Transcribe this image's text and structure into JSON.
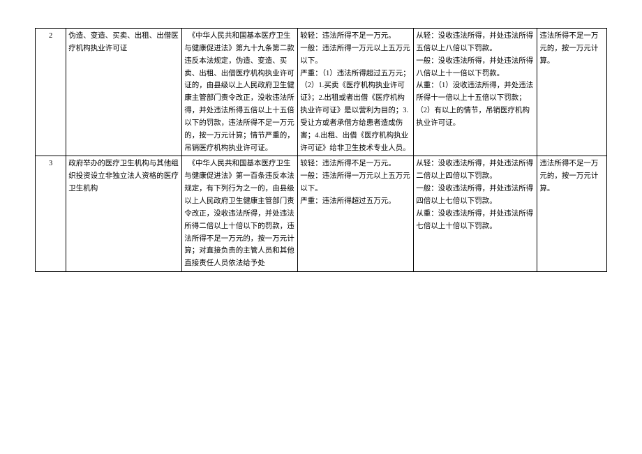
{
  "rows": [
    {
      "num": "2",
      "c2": "伪造、变造、买卖、出租、出借医疗机构执业许可证",
      "c3": "　《中华人民共和国基本医疗卫生与健康促进法》第九十九条第二款违反本法规定，伪造、变造、买卖、出租、出借医疗机构执业许可证的，由县级以上人民政府卫生健康主管部门责令改正，没收违法所得，并处违法所得五倍以上十五倍以下的罚款，违法所得不足一万元的，按一万元计算；情节严重的，吊销医疗机构执业许可证。",
      "c4": "较轻：违法所得不足一万元。\n一般：违法所得一万元以上五万元以下。\n严重：（1）违法所得超过五万元；（2）1.买卖《医疗机构执业许可证》；2.出租或者出借《医疗机构执业许可证》是以营利为目的；3.受让方或者承借方给患者造成伤害；4.出租、出借《医疗机构执业许可证》给非卫生技术专业人员。",
      "c5": "从轻：没收违法所得，并处违法所得五倍以上八倍以下罚款。\n一般：没收违法所得，并处违法所得八倍以上十一倍以下罚款。\n从重：（1）没收违法所得，并处违法所得十一倍以上十五倍以下罚款；（2）有以上的情节，吊销医疗机构执业许可证。",
      "c6": "违法所得不足一万元的，按一万元计算。"
    },
    {
      "num": "3",
      "c2": "政府举办的医疗卫生机构与其他组织投资设立非独立法人资格的医疗卫生机构",
      "c3": "　《中华人民共和国基本医疗卫生与健康促进法》第一百条违反本法规定，有下列行为之一的，由县级以上人民政府卫生健康主管部门责令改正，没收违法所得，并处违法所得二倍以上十倍以下的罚款，违法所得不足一万元的，按一万元计算；对直接负责的主管人员和其他直接责任人员依法给予处",
      "c4": "较轻：违法所得不足一万元。\n一般：违法所得一万元以上五万元以下。\n严重：违法所得超过五万元。",
      "c5": "从轻：没收违法所得，并处违法所得二倍以上四倍以下罚款。\n一般：没收违法所得，并处违法所得四倍以上七倍以下罚款。\n从重：没收违法所得，并处违法所得七倍以上十倍以下罚款。",
      "c6": "违法所得不足一万元的，按一万元计算。"
    }
  ]
}
